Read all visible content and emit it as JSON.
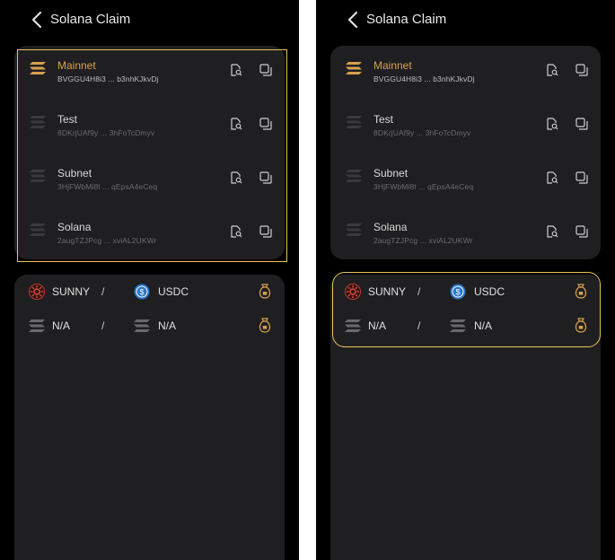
{
  "app_title": "Solana Claim",
  "networks": [
    {
      "name": "Mainnet",
      "address": "BVGGU4H8i3 ... b3nhKJkvDj",
      "active": true
    },
    {
      "name": "Test",
      "address": "8DKrjUAf9y ... 3hFoTcDmyv",
      "active": false
    },
    {
      "name": "Subnet",
      "address": "3HjFWbMi8t ... qEpsA4eCeq",
      "active": false
    },
    {
      "name": "Solana",
      "address": "2augTZJPcg ... xviAL2UKWr",
      "active": false
    }
  ],
  "pairs": [
    {
      "token_a": "SUNNY",
      "separator": "/",
      "token_b": "USDC"
    },
    {
      "token_a": "N/A",
      "separator": "/",
      "token_b": "N/A"
    }
  ],
  "colors": {
    "accent": "#d6a14f",
    "highlight": "#e7c25a",
    "card": "#1f1f21",
    "background": "#000000"
  },
  "icons": {
    "back": "chevron-left-icon",
    "network": "solana-logo-icon",
    "view": "document-search-icon",
    "copy": "copy-icon",
    "claim": "money-bag-icon",
    "sunny": "sunny-logo-icon",
    "usdc": "usdc-logo-icon"
  }
}
